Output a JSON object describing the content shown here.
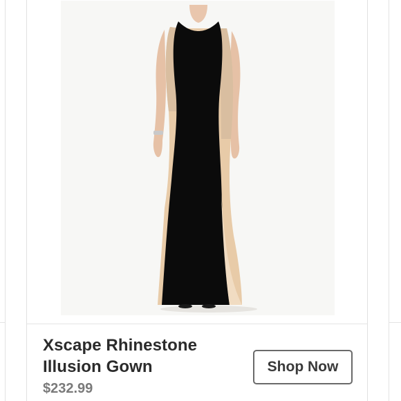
{
  "product": {
    "title": "Xscape Rhinestone Illusion Gown",
    "price": "$232.99",
    "image_alt": "Black gown with nude rhinestone illusion side panels"
  },
  "actions": {
    "shop_label": "Shop Now"
  },
  "colors": {
    "gown_black": "#0b0b0b",
    "illusion_nude": "#e8cba8",
    "skin": "#e9c6ad",
    "title_text": "#2b2b2b",
    "price_text": "#7a7a7a",
    "button_border": "#6a6a6a"
  }
}
